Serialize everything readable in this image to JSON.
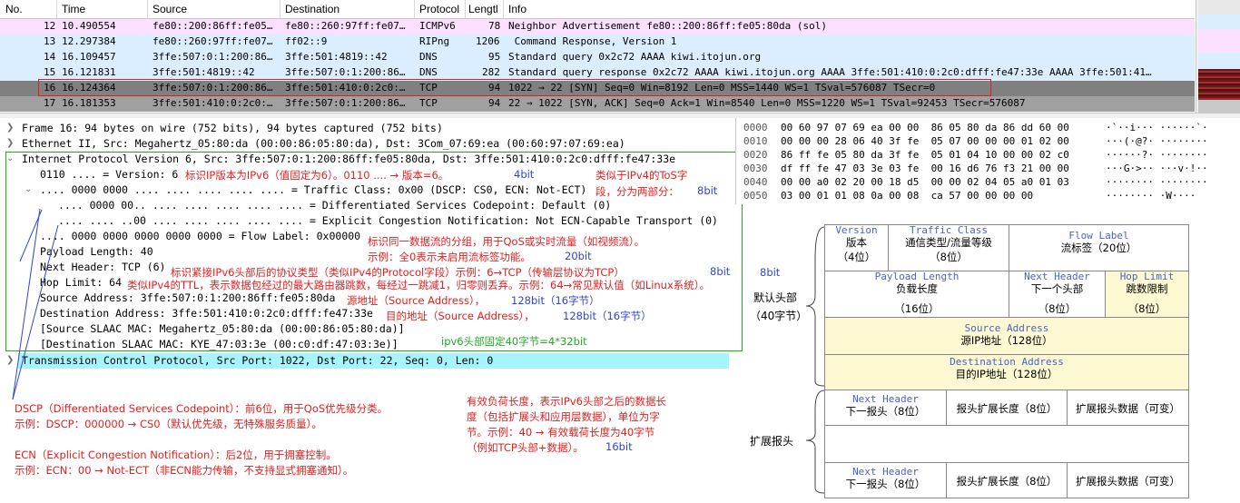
{
  "packet_list": {
    "columns": [
      "No.",
      "Time",
      "Source",
      "Destination",
      "Protocol",
      "Lengtl",
      "Info"
    ],
    "rows": [
      {
        "no": "12",
        "time": "10.490554",
        "src": "fe80::200:86ff:fe05…",
        "dst": "fe80::260:97ff:fe07…",
        "proto": "ICMPv6",
        "len": "78",
        "info": "Neighbor Advertisement fe80::200:86ff:fe05:80da (sol)"
      },
      {
        "no": "13",
        "time": "12.297384",
        "src": "fe80::260:97ff:fe07…",
        "dst": "ff02::9",
        "proto": "RIPng",
        "len": "1206",
        "info": " Command Response, Version 1"
      },
      {
        "no": "14",
        "time": "16.109457",
        "src": "3ffe:507:0:1:200:86…",
        "dst": "3ffe:501:4819::42",
        "proto": "DNS",
        "len": "95",
        "info": "Standard query 0x2c72 AAAA kiwi.itojun.org"
      },
      {
        "no": "15",
        "time": "16.121831",
        "src": "3ffe:501:4819::42",
        "dst": "3ffe:507:0:1:200:86…",
        "proto": "DNS",
        "len": "282",
        "info": "Standard query response 0x2c72 AAAA kiwi.itojun.org AAAA 3ffe:501:410:0:2c0:dfff:fe47:33e AAAA 3ffe:501:41…"
      },
      {
        "no": "16",
        "time": "16.124364",
        "src": "3ffe:507:0:1:200:86…",
        "dst": "3ffe:501:410:0:2c0:…",
        "proto": "TCP",
        "len": "94",
        "info": "1022 → 22 [SYN] Seq=0 Win=8192 Len=0 MSS=1440 WS=1 TSval=576087 TSecr=0"
      },
      {
        "no": "17",
        "time": "16.181353",
        "src": "3ffe:501:410:0:2c0:…",
        "dst": "3ffe:507:0:1:200:86…",
        "proto": "TCP",
        "len": "94",
        "info": "22 → 1022 [SYN, ACK] Seq=0 Ack=1 Win=8540 Len=0 MSS=1220 WS=1 TSval=92453 TSecr=576087"
      }
    ]
  },
  "detail": {
    "frame": "Frame 16: 94 bytes on wire (752 bits), 94 bytes captured (752 bits)",
    "ethernet": "Ethernet II, Src: Megahertz_05:80:da (00:00:86:05:80:da), Dst: 3Com_07:69:ea (00:60:97:07:69:ea)",
    "ipv6": "Internet Protocol Version 6, Src: 3ffe:507:0:1:200:86ff:fe05:80da, Dst: 3ffe:501:410:0:2c0:dfff:fe47:33e",
    "version": "0110 .... = Version: 6",
    "traffic_class": ".... 0000 0000 .... .... .... .... .... = Traffic Class: 0x00 (DSCP: CS0, ECN: Not-ECT)",
    "dscp": ".... 0000 00.. .... .... .... .... .... = Differentiated Services Codepoint: Default (0)",
    "ecn": ".... .... ..00 .... .... .... .... .... = Explicit Congestion Notification: Not ECN-Capable Transport (0)",
    "flow_label": ".... 0000 0000 0000 0000 0000 = Flow Label: 0x00000",
    "payload_length": "Payload Length: 40",
    "next_header": "Next Header: TCP (6)",
    "hop_limit": "Hop Limit: 64",
    "src_addr": "Source Address: 3ffe:507:0:1:200:86ff:fe05:80da",
    "dst_addr": "Destination Address: 3ffe:501:410:0:2c0:dfff:fe47:33e",
    "src_slaac": "[Source SLAAC MAC: Megahertz_05:80:da (00:00:86:05:80:da)]",
    "dst_slaac": "[Destination SLAAC MAC: KYE_47:03:3e (00:c0:df:47:03:3e)]",
    "tcp": "Transmission Control Protocol, Src Port: 1022, Dst Port: 22, Seq: 0, Len: 0"
  },
  "notes": {
    "version_red": "标识IP版本为IPv6（值固定为6）。0110 .... → 版本=6。",
    "version_blue": "4bit",
    "tc_red1": "类似于IPv4的ToS字",
    "tc_red2": "段，分为两部分：",
    "tc_blue": "8bit",
    "flow_red1": "标识同一数据流的分组，用于QoS或实时流量（如视频流）。",
    "flow_red2": "示例：全0表示未启用流标签功能。",
    "flow_blue": "20bit",
    "nh_red": "标识紧接IPv6头部后的协议类型（类似IPv4的Protocol字段）示例：6→TCP（传输层协议为TCP）",
    "nh_blue": "8bit",
    "hop_red": "类似IPv4的TTL，表示数据包经过的最大路由器跳数，每经过一跳减1，归零则丢弃。示例：64→常见默认值（如Linux系统）。",
    "hop_blue": "8bit",
    "src_red": "源地址（Source Address），",
    "src_blue": "128bit（16字节）",
    "dst_red": "目的地址（Source Address），",
    "dst_blue": "128bit（16字节）",
    "fixed_green": "ipv6头部固定40字节=4*32bit",
    "dscp_red1": "DSCP（Differentiated Services Codepoint）：前6位，用于QoS优先级分类。",
    "dscp_red2": "示例：DSCP：000000 → CS0（默认优先级，无特殊服务质量）。",
    "ecn_red1": "ECN（Explicit Congestion Notification）：后2位，用于拥塞控制。",
    "ecn_red2": "示例：ECN：00 → Not-ECT（非ECN能力传输，不支持显式拥塞通知）。",
    "pl_red1": "有效负荷长度，表示IPv6头部之后的数据长",
    "pl_red2": "度（包括扩展头和应用层数据），单位为字",
    "pl_red3": "节。示例：40 → 有效载荷长度为40字节",
    "pl_red4": "（例如TCP头部+数据）。",
    "pl_blue": "16bit"
  },
  "hex": {
    "offsets": [
      "0000",
      "0010",
      "0020",
      "0030",
      "0040",
      "0050"
    ],
    "bytes": [
      "00 60 97 07 69 ea 00 00  86 05 80 da 86 dd 60 00",
      "00 00 00 28 06 40 3f fe  05 07 00 00 00 01 02 00",
      "86 ff fe 05 80 da 3f fe  05 01 04 10 00 00 02 c0",
      "df ff fe 47 03 3e 03 fe  00 16 d6 76 f3 21 00 00",
      "00 00 a0 02 20 00 18 d5  00 00 02 04 05 a0 01 03",
      "03 00 01 01 08 0a 00 08  ca 57 00 00 00 00"
    ],
    "ascii": [
      "·`··i··· ······`·",
      "···(·@?· ········",
      "······?· ········",
      "···G·>·· ···v·!··",
      "········ ········",
      "········ ·W····"
    ]
  },
  "diagram": {
    "default_header_label": "默认头部",
    "default_header_bytes": "（40字节）",
    "ext_header_label": "扩展报头",
    "version": {
      "en": "Version",
      "zh": "版本",
      "bits": "（4位）"
    },
    "traffic_class": {
      "en": "Traffic Class",
      "zh": "通信类型/流量等级",
      "bits": "（8位）"
    },
    "flow_label": {
      "en": "Flow Label",
      "zh": "流标签（20位）"
    },
    "payload_length": {
      "en": "Payload Length",
      "zh": "负载长度",
      "bits": "（16位）"
    },
    "next_header": {
      "en": "Next Header",
      "zh": "下一个头部",
      "bits": "（8位）"
    },
    "hop_limit": {
      "en": "Hop Limit",
      "zh": "跳数限制",
      "bits": "（8位）"
    },
    "source_address": {
      "en": "Source Address",
      "zh": "源IP地址（128位）"
    },
    "destination_address": {
      "en": "Destination Address",
      "zh": "目的IP地址（128位）"
    },
    "ext1_next": {
      "en": "Next Header",
      "zh": "下一报头（8位）"
    },
    "ext1_len": "报头扩展长度（8位）",
    "ext1_data": "扩展报头数据（可变）",
    "ext2_next": {
      "en": "Next Header",
      "zh": "下一报头（8位）"
    },
    "ext2_len": "报头扩展长度（8位）",
    "ext2_data": "扩展报头数据（可变）"
  }
}
